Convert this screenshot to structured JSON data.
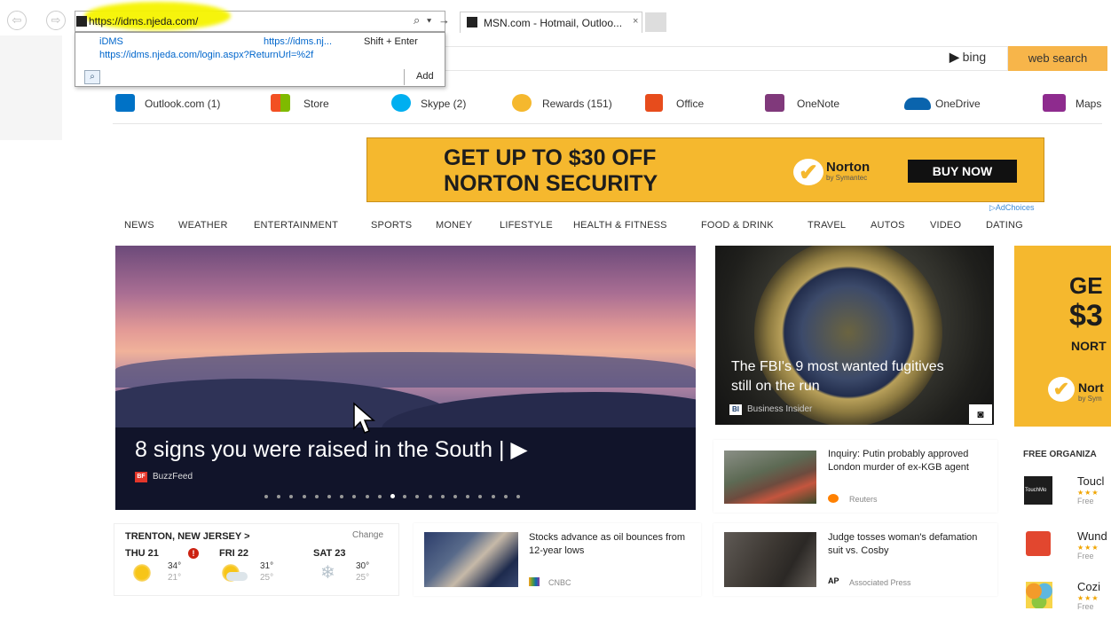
{
  "browser": {
    "address_url": "https://idms.njeda.com/",
    "tab_title": "MSN.com - Hotmail, Outloo...",
    "tab_close": "×",
    "address_tools": "⌕ ▾ →",
    "back_glyph": "⇦",
    "forward_glyph": "⇨",
    "autocomplete": {
      "row1_title": "iDMS",
      "row1_url": "https://idms.nj...",
      "row1_hint": "Shift + Enter",
      "row2_url": "https://idms.njeda.com/login.aspx?ReturnUrl=%2f",
      "search_glyph": "⌕",
      "add_label": "Add"
    }
  },
  "header": {
    "bing_label": "bing",
    "web_search_label": "web search"
  },
  "quick_links": [
    {
      "label": "Outlook.com (1)",
      "icon": "outlook-icon",
      "color": "#0072c6"
    },
    {
      "label": "Store",
      "icon": "store-icon",
      "color": "#f25022"
    },
    {
      "label": "Skype (2)",
      "icon": "skype-icon",
      "color": "#00aff0"
    },
    {
      "label": "Rewards (151)",
      "icon": "rewards-icon",
      "color": "#f5b82e"
    },
    {
      "label": "Office",
      "icon": "office-icon",
      "color": "#e74c1c"
    },
    {
      "label": "OneNote",
      "icon": "onenote-icon",
      "color": "#80397b"
    },
    {
      "label": "OneDrive",
      "icon": "onedrive-icon",
      "color": "#0a64ad"
    },
    {
      "label": "Maps",
      "icon": "maps-icon",
      "color": "#8e2b8e"
    }
  ],
  "ad": {
    "line1": "GET UP TO $30 OFF",
    "line2": "NORTON SECURITY",
    "brand": "Norton",
    "brand_sub": "by Symantec",
    "cta": "BUY NOW",
    "adchoices": "AdChoices",
    "side_line1": "GE",
    "side_line2": "$3",
    "side_line3": "NORT",
    "side_brand": "Nort",
    "side_sub": "by Sym"
  },
  "categories": [
    "NEWS",
    "WEATHER",
    "ENTERTAINMENT",
    "SPORTS",
    "MONEY",
    "LIFESTYLE",
    "HEALTH & FITNESS",
    "FOOD & DRINK",
    "TRAVEL",
    "AUTOS",
    "VIDEO",
    "DATING"
  ],
  "hero": {
    "title": "8 signs you were raised in the South | ▶",
    "source_badge": "BF",
    "source": "BuzzFeed",
    "slide_count": 21,
    "active_slide": 10
  },
  "fbi": {
    "title": "The FBI's 9 most wanted fugitives still on the run",
    "source_badge": "BI",
    "source": "Business Insider"
  },
  "stories": [
    {
      "title": "Inquiry: Putin probably approved London murder of ex-KGB agent",
      "source": "Reuters",
      "badge": "",
      "badge_color": "#ff8000"
    },
    {
      "title": "Stocks advance as oil bounces from 12-year lows",
      "source": "CNBC",
      "badge": "",
      "badge_color": "#5a9e3a"
    },
    {
      "title": "Judge tosses woman's defamation suit vs. Cosby",
      "source": "Associated Press",
      "badge": "AP",
      "badge_color": "#c00"
    }
  ],
  "weather": {
    "location": "TRENTON, NEW JERSEY >",
    "change": "Change",
    "alert": "!",
    "days": [
      {
        "day": "THU 21",
        "hi": "34°",
        "lo": "21°",
        "icon": "sun-icon"
      },
      {
        "day": "FRI 22",
        "hi": "31°",
        "lo": "25°",
        "icon": "partly-cloudy-icon"
      },
      {
        "day": "SAT 23",
        "hi": "30°",
        "lo": "25°",
        "icon": "snow-icon"
      }
    ]
  },
  "apps": {
    "heading": "FREE ORGANIZA",
    "items": [
      {
        "name": "Toucl",
        "stars": "★★★",
        "price": "Free",
        "icon_label": "TouchMo"
      },
      {
        "name": "Wund",
        "stars": "★★★",
        "price": "Free",
        "icon_label": ""
      },
      {
        "name": "Cozi",
        "stars": "★★★",
        "price": "Free",
        "icon_label": ""
      }
    ]
  }
}
